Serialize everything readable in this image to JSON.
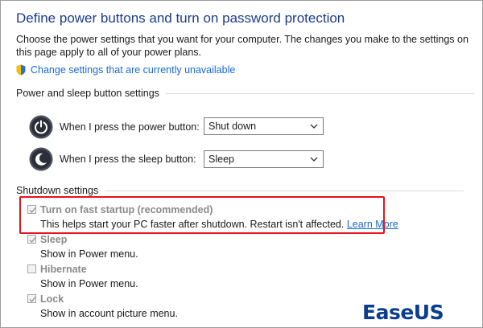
{
  "page": {
    "title": "Define power buttons and turn on password protection",
    "description": "Choose the power settings that you want for your computer. The changes you make to the settings on this page apply to all of your power plans.",
    "change_link": "Change settings that are currently unavailable"
  },
  "power_sleep": {
    "heading": "Power and sleep button settings",
    "power_label": "When I press the power button:",
    "power_value": "Shut down",
    "sleep_label": "When I press the sleep button:",
    "sleep_value": "Sleep"
  },
  "shutdown": {
    "heading": "Shutdown settings",
    "items": [
      {
        "title": "Turn on fast startup (recommended)",
        "desc": "This helps start your PC faster after shutdown. Restart isn't affected.",
        "link": "Learn More",
        "checked": true
      },
      {
        "title": "Sleep",
        "desc": "Show in Power menu.",
        "checked": true
      },
      {
        "title": "Hibernate",
        "desc": "Show in Power menu.",
        "checked": false
      },
      {
        "title": "Lock",
        "desc": "Show in account picture menu.",
        "checked": true
      }
    ]
  },
  "watermark": {
    "text": "EaseUS"
  },
  "colors": {
    "title": "#1c3c8c",
    "link": "#1a6ad6",
    "highlight": "#e8121d",
    "logo": "#0a3d8f"
  }
}
